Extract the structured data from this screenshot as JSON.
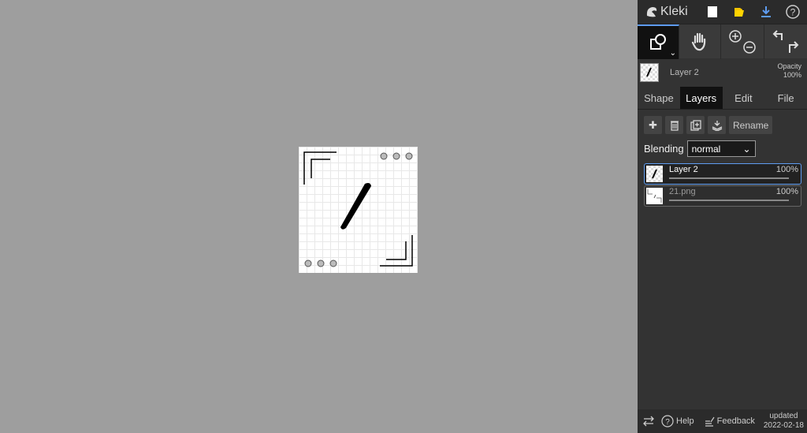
{
  "app": {
    "logo_text": "Kleki"
  },
  "topbar": {
    "icons": [
      "new-document-icon",
      "open-folder-icon",
      "download-icon",
      "help-icon"
    ],
    "accent": "#5e9cf0"
  },
  "tools": [
    "shape-tool",
    "hand-tool",
    "zoom",
    "undo-redo"
  ],
  "current_layer": {
    "name": "Layer 2",
    "opacity_label": "Opacity",
    "opacity_value": "100%"
  },
  "tabs": [
    {
      "label": "Shape",
      "active": false
    },
    {
      "label": "Layers",
      "active": true
    },
    {
      "label": "Edit",
      "active": false
    },
    {
      "label": "File",
      "active": false
    }
  ],
  "layer_tools": {
    "rename_label": "Rename"
  },
  "blending": {
    "label": "Blending",
    "value": "normal"
  },
  "layers": [
    {
      "name": "Layer 2",
      "opacity": "100%",
      "selected": true
    },
    {
      "name": "21.png",
      "opacity": "100%",
      "selected": false
    }
  ],
  "footer": {
    "help_label": "Help",
    "feedback_label": "Feedback",
    "updated_label": "updated",
    "updated_date": "2022-02-18"
  }
}
